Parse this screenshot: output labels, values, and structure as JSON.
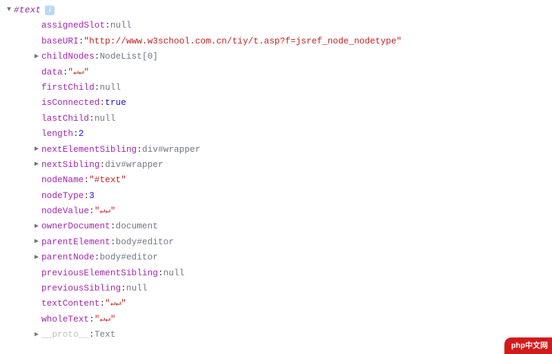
{
  "header": {
    "toggle": "▼",
    "label": "#text",
    "info": "i"
  },
  "props": [
    {
      "key": "assignedSlot",
      "value": "null",
      "vclass": "val-null",
      "expandable": false
    },
    {
      "key": "baseURI",
      "value": "\"http://www.w3school.com.cn/tiy/t.asp?f=jsref_node_nodetype\"",
      "vclass": "val-string",
      "expandable": false
    },
    {
      "key": "childNodes",
      "value": "NodeList[0]",
      "vclass": "val-ident",
      "expandable": true
    },
    {
      "key": "data",
      "value": "\"↵↵\"",
      "vclass": "val-string",
      "expandable": false
    },
    {
      "key": "firstChild",
      "value": "null",
      "vclass": "val-null",
      "expandable": false
    },
    {
      "key": "isConnected",
      "value": "true",
      "vclass": "val-bool",
      "expandable": false
    },
    {
      "key": "lastChild",
      "value": "null",
      "vclass": "val-null",
      "expandable": false
    },
    {
      "key": "length",
      "value": "2",
      "vclass": "val-number",
      "expandable": false
    },
    {
      "key": "nextElementSibling",
      "value": "div#wrapper",
      "vclass": "val-ident",
      "expandable": true
    },
    {
      "key": "nextSibling",
      "value": "div#wrapper",
      "vclass": "val-ident",
      "expandable": true
    },
    {
      "key": "nodeName",
      "value": "\"#text\"",
      "vclass": "val-string",
      "expandable": false
    },
    {
      "key": "nodeType",
      "value": "3",
      "vclass": "val-number",
      "expandable": false
    },
    {
      "key": "nodeValue",
      "value": "\"↵↵\"",
      "vclass": "val-string",
      "expandable": false
    },
    {
      "key": "ownerDocument",
      "value": "document",
      "vclass": "val-ident",
      "expandable": true
    },
    {
      "key": "parentElement",
      "value": "body#editor",
      "vclass": "val-ident",
      "expandable": true
    },
    {
      "key": "parentNode",
      "value": "body#editor",
      "vclass": "val-ident",
      "expandable": true
    },
    {
      "key": "previousElementSibling",
      "value": "null",
      "vclass": "val-null",
      "expandable": false
    },
    {
      "key": "previousSibling",
      "value": "null",
      "vclass": "val-null",
      "expandable": false
    },
    {
      "key": "textContent",
      "value": "\"↵↵\"",
      "vclass": "val-string",
      "expandable": false
    },
    {
      "key": "wholeText",
      "value": "\"↵↵\"",
      "vclass": "val-string",
      "expandable": false
    }
  ],
  "proto": {
    "toggle": "▶",
    "key": "__proto__",
    "value": "Text"
  },
  "glyphs": {
    "collapsed": "▶",
    "expanded": "▼",
    "blank": "▶"
  },
  "watermark": "php中文网"
}
